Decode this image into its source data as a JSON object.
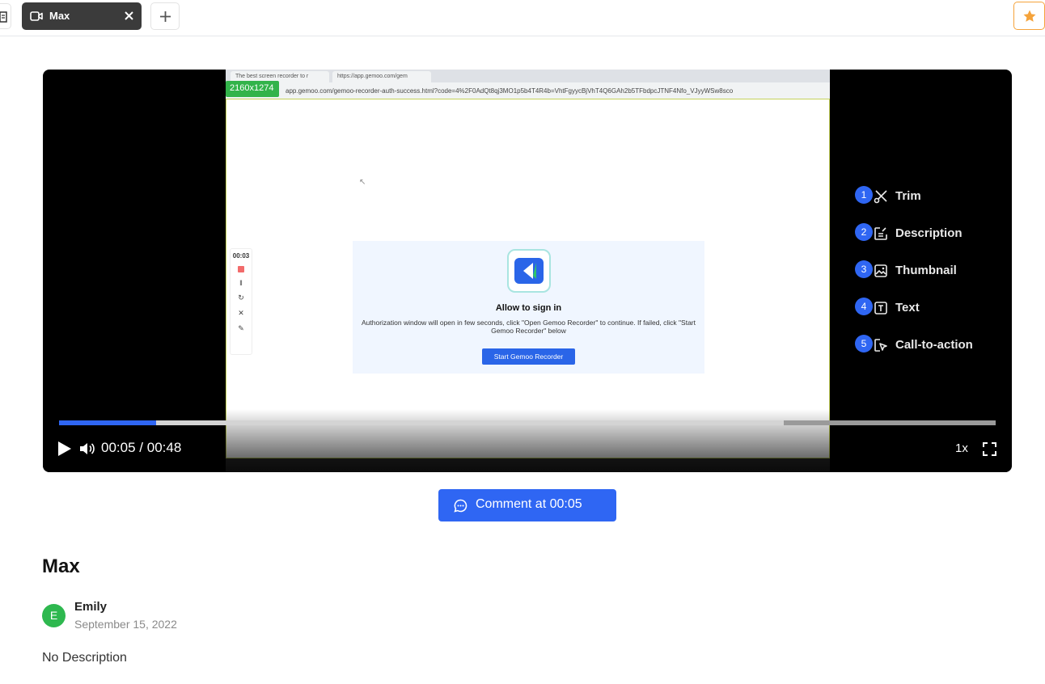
{
  "tab_bar": {
    "active_tab": {
      "label": "Max",
      "icon": "video-camera-icon",
      "close_icon": "close-icon"
    },
    "new_tab_icon": "plus-icon",
    "favorite_icon": "star-icon",
    "favorite_color": "#f5a33b"
  },
  "player": {
    "screen": {
      "browser_tabs": [
        "The best screen recorder to r",
        "https://app.gemoo.com/gem"
      ],
      "url": "app.gemoo.com/gemoo-recorder-auth-success.html?code=4%2F0AdQt8qj3MO1p5b4T4R4b=VhtFgyycBjVhT4Q6GAh2b5TFbdpcJTNF4Nfo_VJyyWSw8sco",
      "resolution_badge": "2160x1274",
      "recorder_panel": {
        "time": "00:03"
      },
      "auth_card": {
        "title": "Allow to sign in",
        "description": "Authorization window will open in few seconds, click \"Open Gemoo Recorder\" to continue. If failed, click \"Start Gemoo Recorder\" below",
        "button": "Start Gemoo Recorder"
      }
    },
    "progress": {
      "played_fraction": 0.104,
      "buffered_fraction": 0.774
    },
    "time": {
      "current": "00:05",
      "separator": "/",
      "total": "00:48"
    },
    "speed": "1x",
    "accent": "#2f66f3",
    "chapters": [
      {
        "number": "1",
        "label": "Trim",
        "icon": "scissors-icon"
      },
      {
        "number": "2",
        "label": "Description",
        "icon": "edit-note-icon"
      },
      {
        "number": "3",
        "label": "Thumbnail",
        "icon": "image-icon"
      },
      {
        "number": "4",
        "label": "Text",
        "icon": "text-box-icon"
      },
      {
        "number": "5",
        "label": "Call-to-action",
        "icon": "cursor-click-icon"
      }
    ]
  },
  "comment_button": {
    "label": "Comment at 00:05",
    "icon": "comment-icon"
  },
  "video": {
    "title": "Max",
    "author": {
      "initial": "E",
      "name": "Emily",
      "avatar_color": "#2eb84f"
    },
    "date": "September 15, 2022",
    "description": "No Description"
  }
}
